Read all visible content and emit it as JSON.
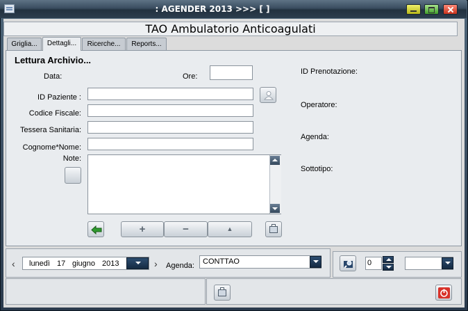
{
  "window": {
    "title": ": AGENDER 2013   >>> [  ]"
  },
  "header": {
    "title": "TAO Ambulatorio Anticoagulati"
  },
  "tabs": [
    {
      "label": "Griglia..."
    },
    {
      "label": "Dettagli..."
    },
    {
      "label": "Ricerche..."
    },
    {
      "label": "Reports..."
    }
  ],
  "form": {
    "section_title": "Lettura Archivio...",
    "data_label": "Data:",
    "ore_label": "Ore:",
    "ore_value": "",
    "id_paziente_label": "ID Paziente :",
    "id_paziente_value": "",
    "codice_fiscale_label": "Codice Fiscale:",
    "codice_fiscale_value": "",
    "tessera_label": "Tessera Sanitaria:",
    "tessera_value": "",
    "cognome_label": "Cognome*Nome:",
    "cognome_value": "",
    "note_label": "Note:",
    "note_value": ""
  },
  "info": {
    "id_prenotazione_label": "ID Prenotazione:",
    "operatore_label": "Operatore:",
    "agenda_label": "Agenda:",
    "sottotipo_label": "Sottotipo:"
  },
  "toolbar": {
    "add_symbol": "+",
    "remove_symbol": "−",
    "up_symbol": "▲"
  },
  "footer": {
    "prev_arrow": "‹",
    "next_arrow": "›",
    "date_weekday": "lunedì",
    "date_day": "17",
    "date_month": "giugno",
    "date_year": "2013",
    "agenda_label": "Agenda:",
    "agenda_value": "CONTTAO",
    "counter_value": "0",
    "extra_select_value": ""
  },
  "icons": {
    "back": "arrow-left-icon",
    "print": "printer-icon",
    "power": "power-icon",
    "search": "search-icon",
    "person": "person-icon"
  },
  "colors": {
    "accent_green": "#3aa63a",
    "power_red": "#d8322a",
    "dropdown_blue": "#1f3b5c"
  }
}
